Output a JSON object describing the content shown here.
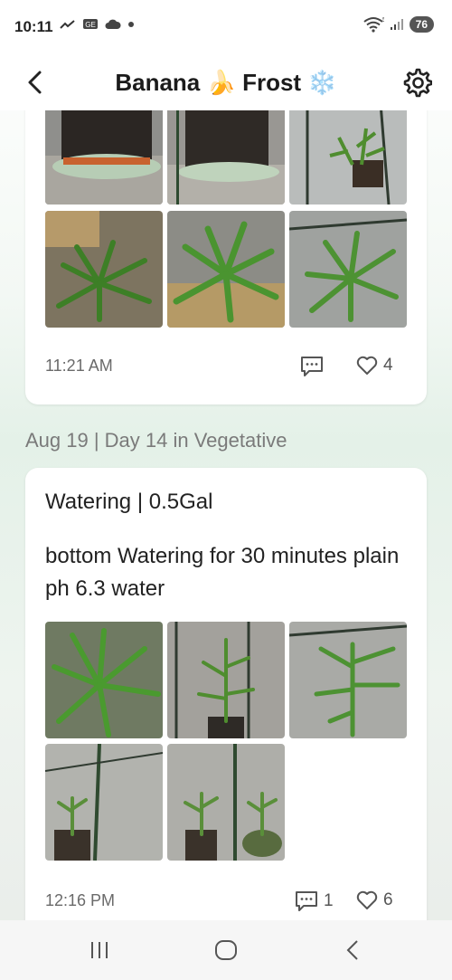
{
  "status": {
    "time": "10:11",
    "battery": "76",
    "signal_label": "5"
  },
  "header": {
    "title": "Banana 🍌 Frost ❄️"
  },
  "post1": {
    "time": "11:21 AM",
    "likes": "4"
  },
  "day_label": "Aug 19 | Day 14 in Vegetative",
  "post2": {
    "title": "Watering | 0.5Gal",
    "body": "bottom Watering for 30 minutes plain ph 6.3 water",
    "time": "12:16 PM",
    "comments": "1",
    "likes": "6"
  },
  "colors": {
    "plant_green": "#3f8a2c",
    "header_bg": "#ffffff",
    "accent_bg": "#e4f1e8"
  }
}
